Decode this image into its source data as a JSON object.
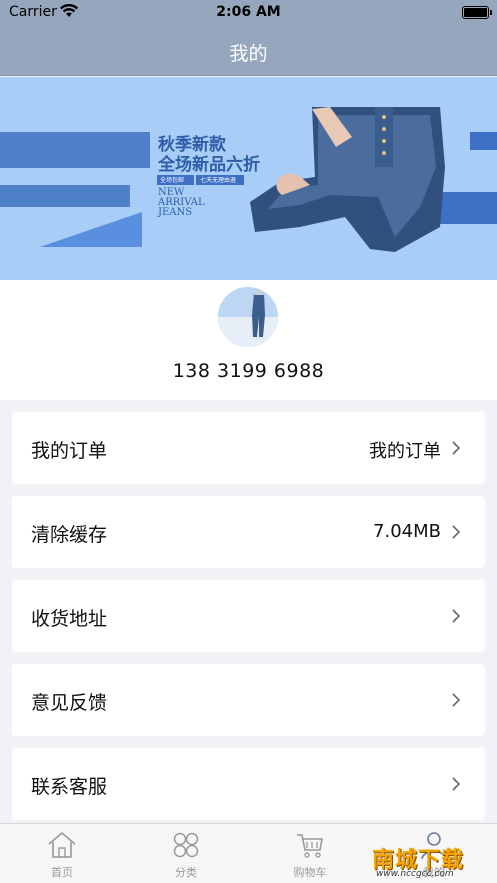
{
  "status_bar": {
    "carrier": "Carrier",
    "time": "2:06 AM"
  },
  "nav": {
    "title": "我的"
  },
  "banner": {
    "headline_1": "秋季新款",
    "headline_2": "全场新品六折",
    "tag_1": "全场包邮",
    "tag_2": "七天无理由退",
    "en_1": "NEW",
    "en_2": "ARRIVAL",
    "en_3": "JEANS"
  },
  "profile": {
    "phone": "138 3199 6988"
  },
  "menu": [
    {
      "label": "我的订单",
      "value": "我的订单"
    },
    {
      "label": "清除缓存",
      "value": "7.04MB"
    },
    {
      "label": "收货地址",
      "value": ""
    },
    {
      "label": "意见反馈",
      "value": ""
    },
    {
      "label": "联系客服",
      "value": ""
    }
  ],
  "tabs": [
    {
      "label": "首页",
      "icon": "home-icon"
    },
    {
      "label": "分类",
      "icon": "category-icon"
    },
    {
      "label": "购物车",
      "icon": "cart-icon"
    },
    {
      "label": "我的",
      "icon": "user-icon"
    }
  ],
  "watermark": {
    "title": "南城下载",
    "url": "www.nccgcc.com"
  },
  "colors": {
    "nav_bg": "#96a6bd",
    "banner_bg": "#a8cdf6",
    "accent_blue": "#3d6fc4",
    "watermark": "#f5a300"
  }
}
